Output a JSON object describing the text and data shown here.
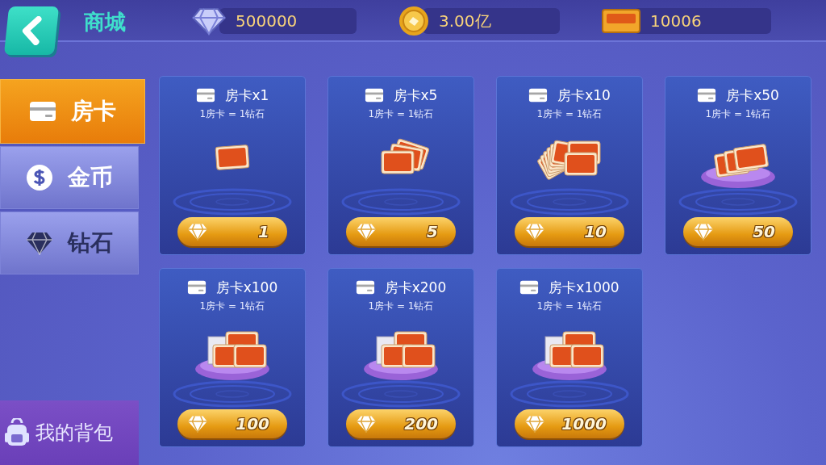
{
  "header": {
    "title": "商城",
    "balances": [
      {
        "kind": "diamond",
        "value": "500000"
      },
      {
        "kind": "coin",
        "value": "3.00亿"
      },
      {
        "kind": "card",
        "value": "10006"
      }
    ]
  },
  "sidebar": {
    "tabs": [
      {
        "kind": "card",
        "label": "房卡",
        "selected": true
      },
      {
        "kind": "coin",
        "label": "金币",
        "selected": false
      },
      {
        "kind": "diamond",
        "label": "钻石",
        "selected": false
      }
    ],
    "backpack": {
      "label": "我的背包"
    }
  },
  "items": [
    {
      "kind": "single",
      "title": "房卡x1",
      "rate": "1房卡 = 1钻石",
      "price": "1"
    },
    {
      "kind": "fan",
      "title": "房卡x5",
      "rate": "1房卡 = 1钻石",
      "price": "5"
    },
    {
      "kind": "wide-fan",
      "title": "房卡x10",
      "rate": "1房卡 = 1钻石",
      "price": "10"
    },
    {
      "kind": "cushion",
      "title": "房卡x50",
      "rate": "1房卡 = 1钻石",
      "price": "50"
    },
    {
      "kind": "pile",
      "title": "房卡x100",
      "rate": "1房卡 = 1钻石",
      "price": "100"
    },
    {
      "kind": "pile",
      "title": "房卡x200",
      "rate": "1房卡 = 1钻石",
      "price": "200"
    },
    {
      "kind": "pile",
      "title": "房卡x1000",
      "rate": "1房卡 = 1钻石",
      "price": "1000"
    }
  ]
}
